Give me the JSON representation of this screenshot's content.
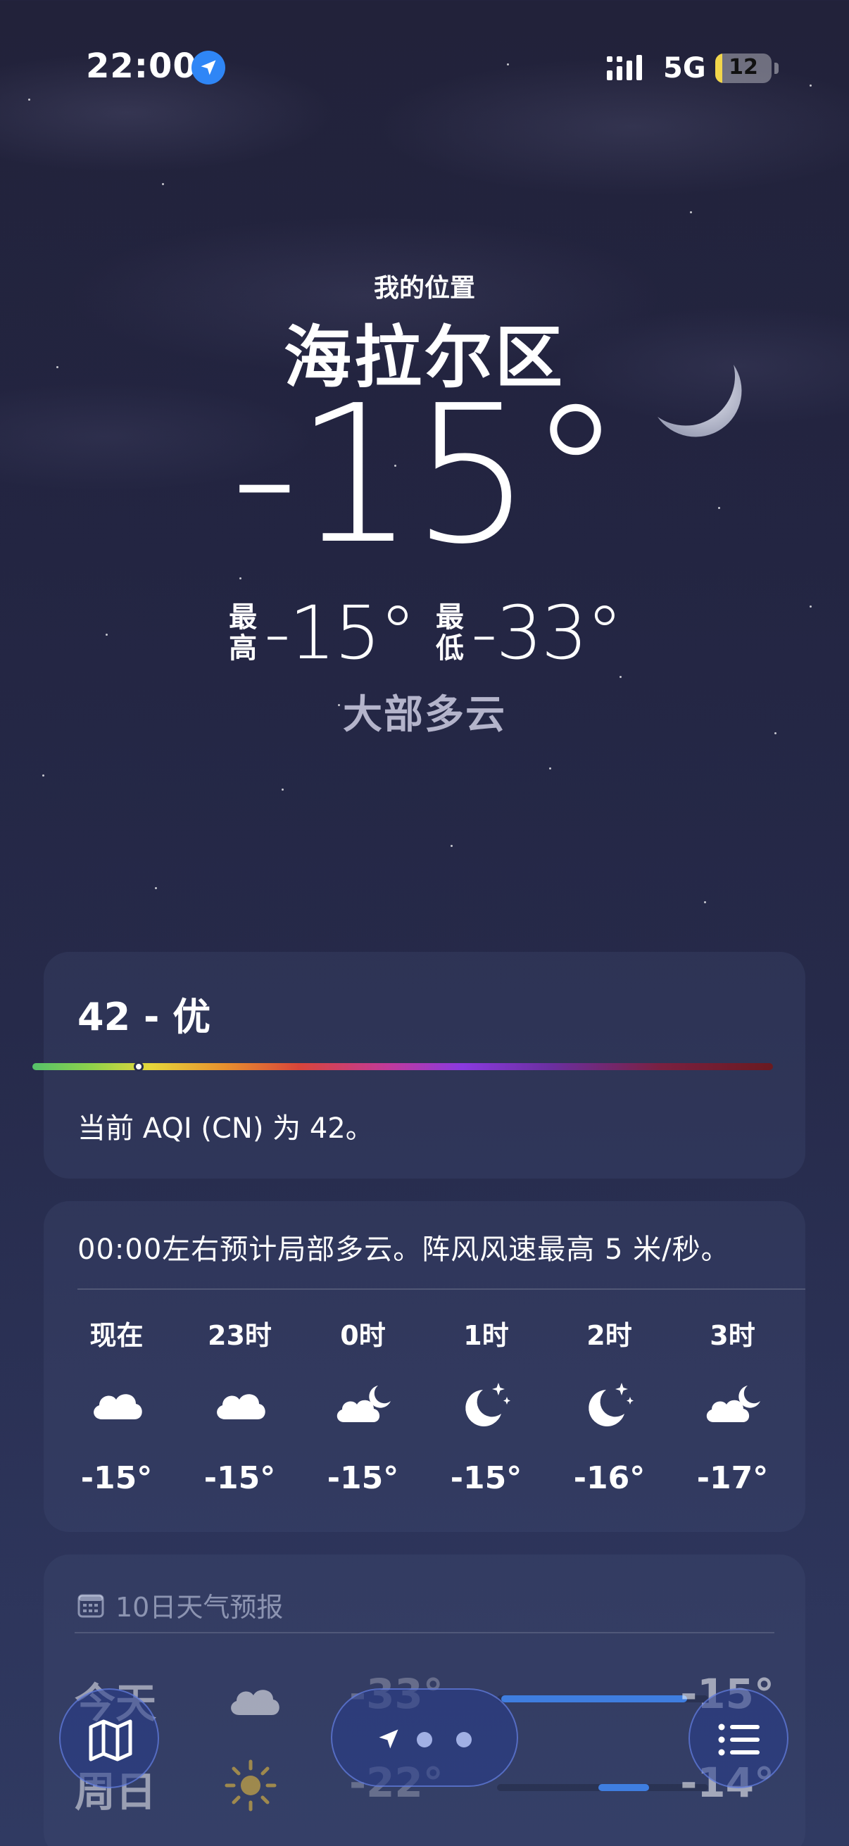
{
  "status_bar": {
    "time": "22:00",
    "network": "5G",
    "battery": "12",
    "battery_level": 0.12
  },
  "hero": {
    "location_label": "我的位置",
    "city": "海拉尔区",
    "temperature": "-15°",
    "high_label": "最高",
    "high": "-15°",
    "low_label": "最低",
    "low": "-33°",
    "condition": "大部多云"
  },
  "aqi": {
    "title": "42 - 优",
    "value": 42,
    "description": "当前 AQI (CN) 为 42。"
  },
  "hourly": {
    "summary": "00:00左右预计局部多云。阵风风速最高 5 米/秒。",
    "items": [
      {
        "label": "现在",
        "icon": "cloud-icon",
        "temp": "-15°"
      },
      {
        "label": "23时",
        "icon": "cloud-icon",
        "temp": "-15°"
      },
      {
        "label": "0时",
        "icon": "partly-cloudy-night-icon",
        "temp": "-15°"
      },
      {
        "label": "1时",
        "icon": "clear-night-icon",
        "temp": "-15°"
      },
      {
        "label": "2时",
        "icon": "clear-night-icon",
        "temp": "-16°"
      },
      {
        "label": "3时",
        "icon": "partly-cloudy-night-icon",
        "temp": "-17°"
      }
    ]
  },
  "daily": {
    "header": "10日天气预报",
    "days": [
      {
        "name": "今天",
        "icon": "cloud-icon",
        "low": "-33°",
        "high": "-15°"
      },
      {
        "name": "周日",
        "icon": "sun-icon",
        "low": "-22°",
        "high": "-14°"
      }
    ]
  },
  "colors": {
    "accent": "#2f86f6",
    "battery": "#f2d64b",
    "temp_bar": "#3f7ee0"
  }
}
